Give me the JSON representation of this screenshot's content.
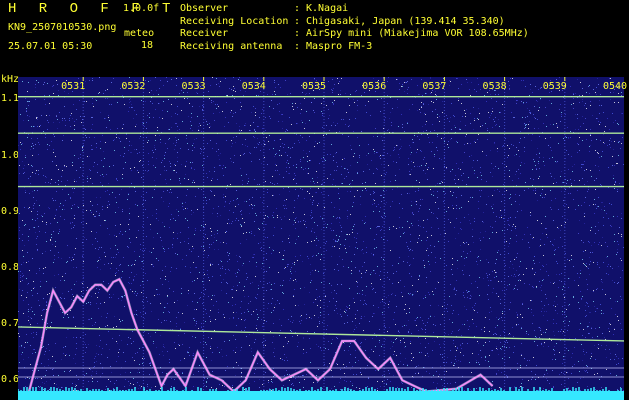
{
  "header": {
    "logo": "H R O F F T",
    "version": "1.0.0f",
    "filename": "KN9_2507010530.png",
    "meteo_label": "meteo",
    "meteo_count": "18",
    "timestamp": "25.07.01 05:30"
  },
  "info": [
    {
      "key": "Observer",
      "value": "K.Nagai"
    },
    {
      "key": "Receiving Location",
      "value": "Chigasaki, Japan (139.414 35.340)"
    },
    {
      "key": "Receiver",
      "value": "AirSpy mini (Miakejima VOR 108.65MHz)"
    },
    {
      "key": "Receiving antenna",
      "value": "Maspro FM-3"
    }
  ],
  "colors": {
    "text": "#ffff33",
    "background": "#10106a",
    "carrier": "#bfffa0",
    "trace": "#ff88ff",
    "bottom_band": "#35e8ff"
  },
  "chart_data": {
    "type": "heatmap",
    "ylabel": "kHz",
    "yticks": [
      "1.1",
      "1.0",
      "0.9",
      "0.8",
      "0.7",
      "0.6"
    ],
    "xticks": [
      "0531",
      "0532",
      "0533",
      "0534",
      "0535",
      "0536",
      "0537",
      "0538",
      "0539",
      "0540"
    ],
    "ylim": [
      0.565,
      1.14
    ],
    "xlim": [
      "05:30",
      "05:40"
    ],
    "horizontal_lines_khz": [
      1.105,
      1.04,
      0.945,
      0.695
    ],
    "trace_khz": [
      [
        0.1,
        0.58
      ],
      [
        0.2,
        0.62
      ],
      [
        0.3,
        0.66
      ],
      [
        0.4,
        0.72
      ],
      [
        0.5,
        0.76
      ],
      [
        0.6,
        0.74
      ],
      [
        0.7,
        0.72
      ],
      [
        0.8,
        0.73
      ],
      [
        0.9,
        0.75
      ],
      [
        1.0,
        0.74
      ],
      [
        1.1,
        0.76
      ],
      [
        1.2,
        0.77
      ],
      [
        1.3,
        0.77
      ],
      [
        1.4,
        0.76
      ],
      [
        1.5,
        0.775
      ],
      [
        1.6,
        0.78
      ],
      [
        1.7,
        0.76
      ],
      [
        1.8,
        0.72
      ],
      [
        1.9,
        0.69
      ],
      [
        2.0,
        0.67
      ],
      [
        2.1,
        0.65
      ],
      [
        2.2,
        0.62
      ],
      [
        2.3,
        0.59
      ],
      [
        2.4,
        0.61
      ],
      [
        2.5,
        0.62
      ],
      [
        2.7,
        0.59
      ],
      [
        2.9,
        0.65
      ],
      [
        3.1,
        0.61
      ],
      [
        3.3,
        0.6
      ],
      [
        3.5,
        0.58
      ],
      [
        3.7,
        0.6
      ],
      [
        3.9,
        0.65
      ],
      [
        4.1,
        0.62
      ],
      [
        4.3,
        0.6
      ],
      [
        4.5,
        0.61
      ],
      [
        4.7,
        0.62
      ],
      [
        4.9,
        0.6
      ],
      [
        5.1,
        0.62
      ],
      [
        5.3,
        0.67
      ],
      [
        5.5,
        0.67
      ],
      [
        5.7,
        0.64
      ],
      [
        5.9,
        0.62
      ],
      [
        6.1,
        0.64
      ],
      [
        6.3,
        0.6
      ],
      [
        6.5,
        0.59
      ],
      [
        6.7,
        0.58
      ],
      [
        7.2,
        0.585
      ],
      [
        7.6,
        0.61
      ],
      [
        7.8,
        0.59
      ]
    ]
  }
}
